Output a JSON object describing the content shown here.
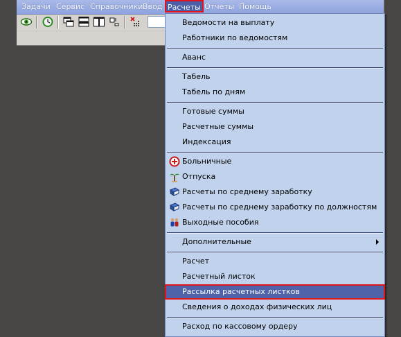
{
  "menubar": {
    "items": [
      {
        "label": "Задачи"
      },
      {
        "label": "Сервис"
      },
      {
        "label": "Справочники"
      },
      {
        "label": "Ввод"
      },
      {
        "label": "Расчеты"
      },
      {
        "label": "Отчеты"
      },
      {
        "label": "Помощь"
      }
    ],
    "open_item": "Расчеты"
  },
  "toolbar": {
    "buttons": [
      {
        "icon": "eye-icon"
      },
      {
        "icon": "clock-refresh-icon"
      },
      {
        "icon": "cascade-windows-icon"
      },
      {
        "icon": "tile-horizontal-icon"
      },
      {
        "icon": "tile-vertical-icon"
      },
      {
        "icon": "arrange-icons-icon"
      },
      {
        "icon": "close-grid-icon"
      }
    ]
  },
  "dropdown": {
    "groups": [
      [
        "Ведомости на выплату",
        "Работники по ведомостям"
      ],
      [
        "Аванс"
      ],
      [
        "Табель",
        "Табель по дням"
      ],
      [
        "Готовые суммы",
        "Расчетные суммы",
        "Индексация"
      ],
      [
        "Больничные",
        "Отпуска",
        "Расчеты по среднему заработку",
        "Расчеты по среднему заработку по должностям",
        "Выходные пособия"
      ],
      [
        "Дополнительные"
      ],
      [
        "Расчет",
        "Расчетный листок",
        "Рассылка расчетных листков",
        "Сведения о доходах физических лиц"
      ],
      [
        "Расход по кассовому ордеру"
      ]
    ],
    "item_icons": {
      "Больничные": "first-aid-icon",
      "Отпуска": "palm-tree-icon",
      "Расчеты по среднему заработку": "book-icon",
      "Расчеты по среднему заработку по должностям": "book-icon",
      "Выходные пособия": "people-icon"
    },
    "submenu_item": "Дополнительные",
    "highlighted_item": "Рассылка расчетных листков"
  },
  "colors": {
    "desktop_bg": "#484644",
    "menubar_bg": "#9cafe3",
    "dropdown_bg": "#c1d2ec",
    "highlight_bg": "#4f63a9",
    "annotation_red": "#e0141b"
  }
}
